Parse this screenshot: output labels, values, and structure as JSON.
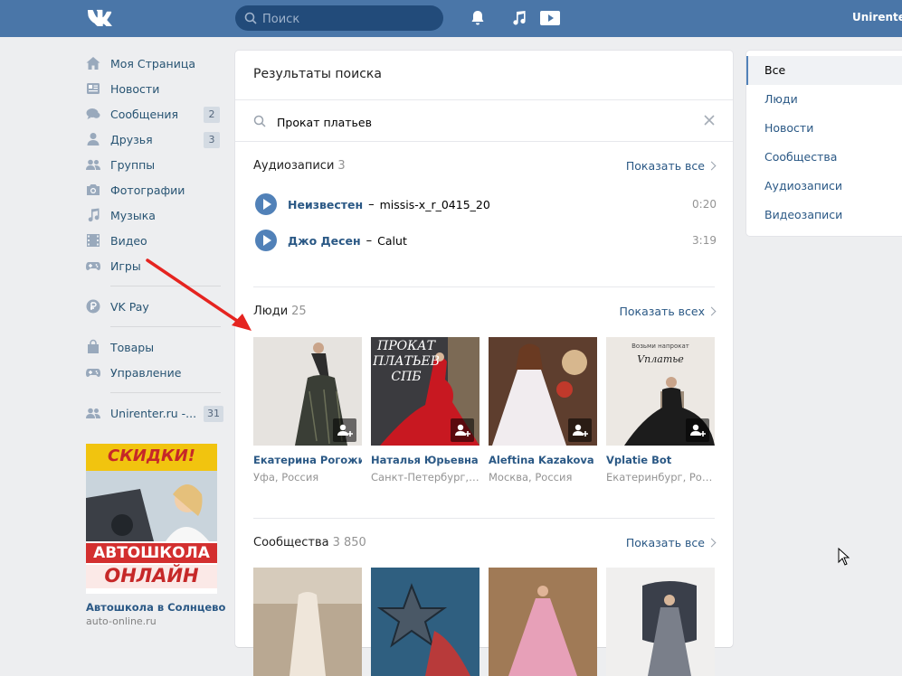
{
  "header": {
    "search_placeholder": "Поиск",
    "user_name": "Unirenter",
    "icons": [
      "vk-logo-icon",
      "search-icon",
      "bell-icon",
      "music-note-icon",
      "play-icon"
    ],
    "colors": {
      "bar": "#4a76a8",
      "search_bg": "#224b7a"
    }
  },
  "sidebar": {
    "items": [
      {
        "label": "Моя Страница",
        "icon": "home-icon"
      },
      {
        "label": "Новости",
        "icon": "news-icon"
      },
      {
        "label": "Сообщения",
        "icon": "chat-bubbles-icon",
        "badge": "2"
      },
      {
        "label": "Друзья",
        "icon": "person-icon",
        "badge": "3"
      },
      {
        "label": "Группы",
        "icon": "group-icon"
      },
      {
        "label": "Фотографии",
        "icon": "camera-icon"
      },
      {
        "label": "Музыка",
        "icon": "music-note-icon"
      },
      {
        "label": "Видео",
        "icon": "film-icon"
      },
      {
        "label": "Игры",
        "icon": "gamepad-icon"
      },
      {
        "label": "VK Pay",
        "icon": "ruble-icon"
      },
      {
        "label": "Товары",
        "icon": "bag-icon"
      },
      {
        "label": "Управление",
        "icon": "gamepad-icon"
      },
      {
        "label": "Unirenter.ru -...",
        "icon": "group-icon",
        "badge": "31"
      }
    ],
    "ad": {
      "banner_top": "СКИДКИ!",
      "banner_mid": "АВТОШКОЛА",
      "banner_bottom": "ОНЛАЙН",
      "title": "Автошкола в Солнцево",
      "domain": "auto-online.ru"
    }
  },
  "main": {
    "title": "Результаты поиска",
    "query": "Прокат платьев",
    "audio": {
      "heading": "Аудиозаписи",
      "count": "3",
      "show_all": "Показать все",
      "tracks": [
        {
          "artist": "Неизвестен",
          "dash": "–",
          "title": "missis-x_r_0415_20",
          "duration": "0:20"
        },
        {
          "artist": "Джо Десен",
          "dash": "–",
          "title": "Calut",
          "duration": "3:19"
        }
      ]
    },
    "people": {
      "heading": "Люди",
      "count": "25",
      "show_all": "Показать всех",
      "items": [
        {
          "name": "Екатерина Рогожина",
          "city": "Уфа, Россия"
        },
        {
          "name": "Наталья Юрьевна",
          "city": "Санкт-Петербург, Р...",
          "photo_text": "ПРОКАТ ПЛАТЬЕВ СПБ"
        },
        {
          "name": "Aleftina Kazakova",
          "city": "Москва, Россия"
        },
        {
          "name": "Vplatie Bot",
          "city": "Екатеринбург, Росс...",
          "photo_text_top": "Возьми напрокат",
          "photo_text_script": "Vплатье"
        }
      ]
    },
    "groups": {
      "heading": "Сообщества",
      "count": "3 850",
      "show_all": "Показать все"
    }
  },
  "filters": {
    "items": [
      "Все",
      "Люди",
      "Новости",
      "Сообщества",
      "Аудиозаписи",
      "Видеозаписи"
    ],
    "active": "Все"
  }
}
